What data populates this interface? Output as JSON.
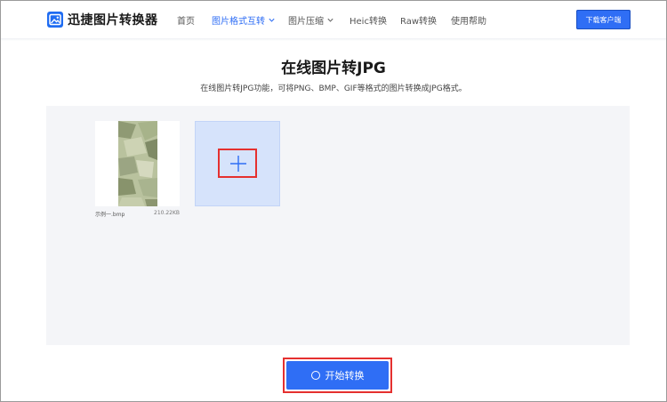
{
  "header": {
    "logo_text": "迅捷图片转换器",
    "logo_icon": "image-icon",
    "nav": [
      {
        "label": "首页"
      },
      {
        "label": "图片格式互转"
      },
      {
        "label": "图片压缩"
      },
      {
        "label": "Heic转换"
      },
      {
        "label": "Raw转换"
      },
      {
        "label": "使用帮助"
      }
    ],
    "download_label": "下载客户端"
  },
  "page": {
    "title": "在线图片转JPG",
    "subtitle": "在线图片转JPG功能，可将PNG、BMP、GIF等格式的图片转换成JPG格式。"
  },
  "files": [
    {
      "name": "示例一.bmp",
      "size": "210.22KB"
    }
  ],
  "add_icon": "plus-icon",
  "start_button": {
    "label": "开始转换",
    "icon": "circle-icon"
  },
  "colors": {
    "accent": "#2f6ef5",
    "highlight": "#e5302f",
    "upload_bg": "#f4f5f8",
    "add_card_bg": "#d6e3fb"
  }
}
